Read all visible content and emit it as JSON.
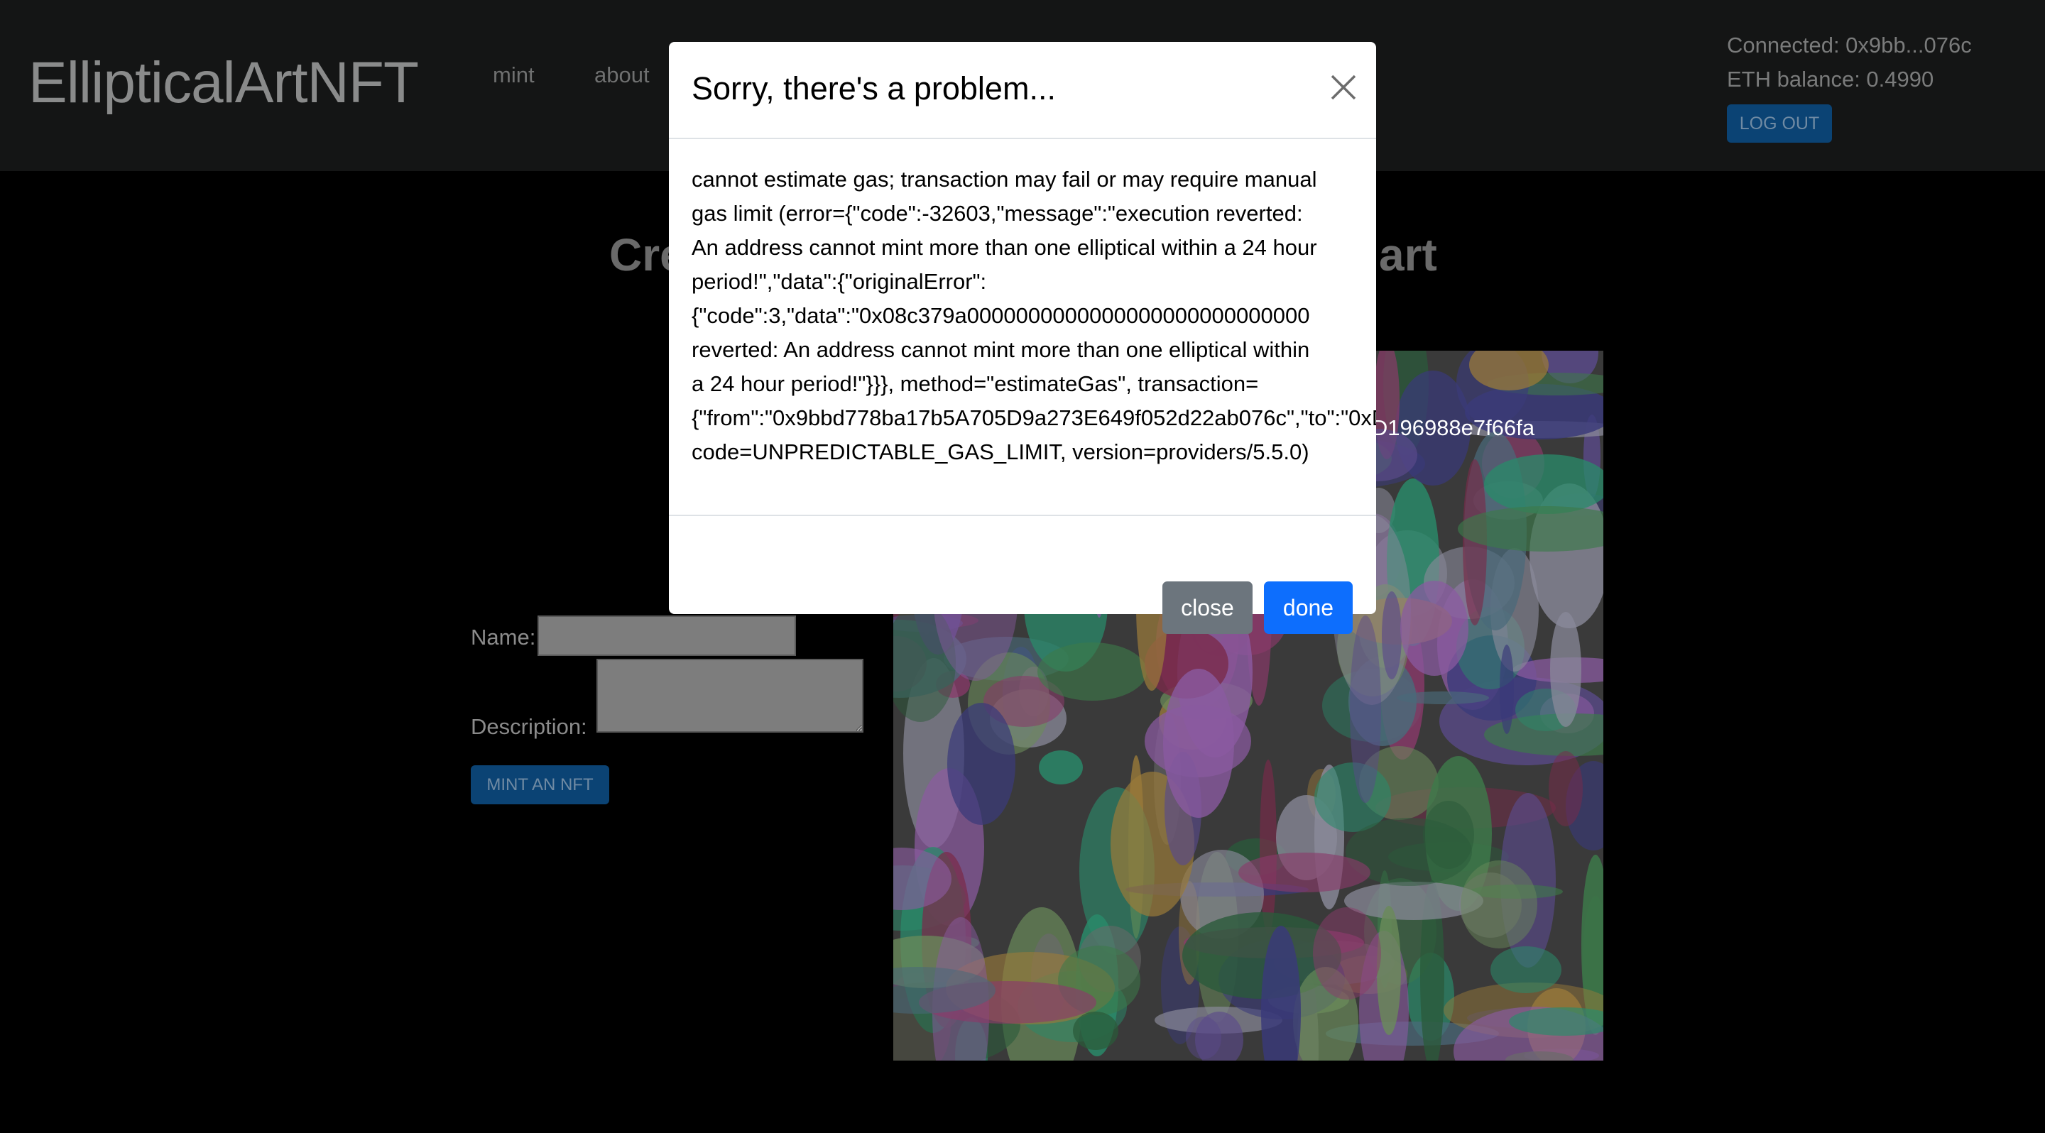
{
  "navbar": {
    "brand": "EllipticalArtNFT",
    "links": [
      "mint",
      "about"
    ],
    "connected": "Connected: 0x9bb...076c",
    "balance": "ETH balance: 0.4990",
    "logout_label": "LOG OUT"
  },
  "main": {
    "heading_left_fragment": "Cre",
    "heading_right_fragment": "art",
    "name_label": "Name:",
    "description_label": "Description:",
    "name_value": "",
    "description_value": "",
    "mint_label": "MINT AN NFT"
  },
  "modal": {
    "title": "Sorry, there's a problem...",
    "lines": [
      "cannot estimate gas; transaction may fail or may require manual",
      "gas limit (error={\"code\":-32603,\"message\":\"execution reverted:",
      "An address cannot mint more than one elliptical within a 24 hour",
      "period!\",\"data\":{\"originalError\":",
      "{\"code\":3,\"data\":\"0x08c379a0000000000000000000000000000",
      "reverted: An address cannot mint more than one elliptical within",
      "a 24 hour period!\"}}}, method=\"estimateGas\", transaction=",
      "{\"from\":\"0x9bbd778ba17b5A705D9a273E649f052d22ab076c\",\"to\":\"0xD196988e7f66fa",
      "code=UNPREDICTABLE_GAS_LIMIT, version=providers/5.5.0)"
    ],
    "close_label": "close",
    "done_label": "done"
  },
  "colors": {
    "primary": "#0d6efd",
    "secondary": "#6c757d"
  }
}
